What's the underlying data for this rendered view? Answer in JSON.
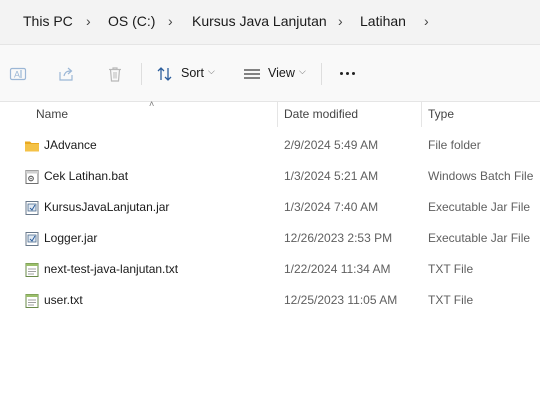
{
  "breadcrumb": {
    "items": [
      "This PC",
      "OS (C:)",
      "Kursus Java Lanjutan",
      "Latihan"
    ]
  },
  "toolbar": {
    "sort_label": "Sort",
    "view_label": "View"
  },
  "columns": {
    "name": "Name",
    "date": "Date modified",
    "type": "Type"
  },
  "files": [
    {
      "name": "JAdvance",
      "date": "2/9/2024 5:49 AM",
      "type": "File folder",
      "icon": "folder-icon"
    },
    {
      "name": "Cek Latihan.bat",
      "date": "1/3/2024 5:21 AM",
      "type": "Windows Batch File",
      "icon": "batch-file-icon"
    },
    {
      "name": "KursusJavaLanjutan.jar",
      "date": "1/3/2024 7:40 AM",
      "type": "Executable Jar File",
      "icon": "jar-file-icon"
    },
    {
      "name": "Logger.jar",
      "date": "12/26/2023 2:53 PM",
      "type": "Executable Jar File",
      "icon": "jar-file-icon"
    },
    {
      "name": "next-test-java-lanjutan.txt",
      "date": "1/22/2024 11:34 AM",
      "type": "TXT File",
      "icon": "text-file-icon"
    },
    {
      "name": "user.txt",
      "date": "12/25/2023 11:05 AM",
      "type": "TXT File",
      "icon": "text-file-icon"
    }
  ],
  "colors": {
    "folder": "#f4c247",
    "accent": "#0067c0"
  }
}
